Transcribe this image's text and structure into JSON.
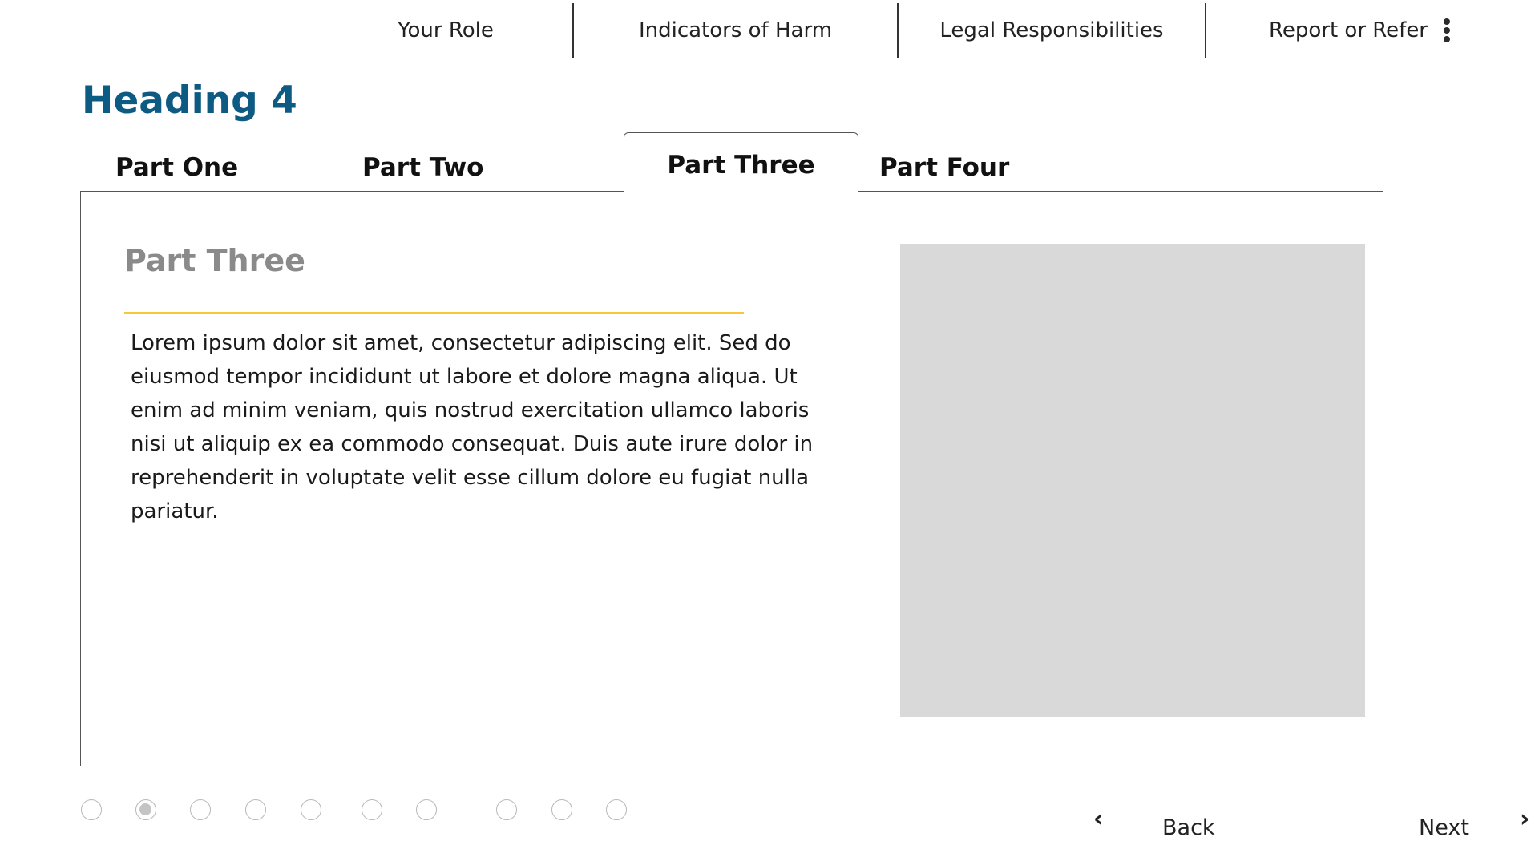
{
  "nav": {
    "items": [
      {
        "label": "Your Role"
      },
      {
        "label": "Indicators of Harm"
      },
      {
        "label": "Legal Responsibilities"
      },
      {
        "label": "Report or Refer"
      }
    ],
    "menu_icon": "more-vertical-icon"
  },
  "heading": "Heading 4",
  "tabs": [
    {
      "label": "Part One",
      "selected": false
    },
    {
      "label": "Part Two",
      "selected": false
    },
    {
      "label": "Part Three",
      "selected": true
    },
    {
      "label": "Part Four",
      "selected": false
    }
  ],
  "panel": {
    "title": "Part Three",
    "body": "Lorem ipsum dolor sit amet, consectetur adipiscing elit. Sed do eiusmod tempor incididunt ut labore et dolore magna aliqua. Ut enim ad minim veniam, quis nostrud exercitation ullamco laboris nisi ut aliquip ex ea commodo consequat. Duis aute irure dolor in reprehenderit in voluptate velit esse cillum dolore eu fugiat nulla pariatur.",
    "image_placeholder": true
  },
  "progress": {
    "total": 10,
    "current": 2
  },
  "footer": {
    "back_label": "Back",
    "next_label": "Next",
    "back_icon": "chevron-left-icon",
    "next_icon": "chevron-right-icon"
  },
  "colors": {
    "heading": "#0d5a82",
    "panel_title": "#8a8a8a",
    "accent_underline": "#f7c83a",
    "placeholder": "#d9d9d9"
  }
}
